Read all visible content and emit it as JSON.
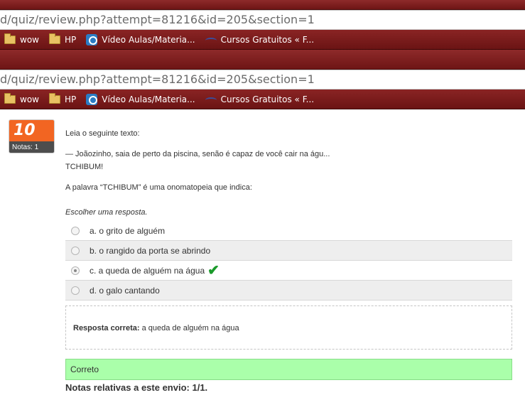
{
  "browser": {
    "url": "d/quiz/review.php?attempt=81216&id=205&section=1",
    "bookmarks": [
      {
        "icon": "folder-icon",
        "label": "wow"
      },
      {
        "icon": "folder-icon",
        "label": "HP"
      },
      {
        "icon": "site-icon",
        "label": "Vídeo Aulas/Materia..."
      },
      {
        "icon": "bird-icon",
        "label": "Cursos Gratuitos « F..."
      }
    ]
  },
  "question": {
    "number": "10",
    "grade_label": "Notas: 1",
    "intro": "Leia o seguinte texto:",
    "quote_line1": "— Joãozinho, saia de perto da piscina, senão é capaz de você cair na águ...",
    "quote_line2": "TCHIBUM!",
    "prompt": "A palavra “TCHIBUM” é uma onomatopeia que indica:",
    "choose": "Escolher uma resposta.",
    "answers": [
      {
        "label": "a. o grito de alguém",
        "checked": false
      },
      {
        "label": "b. o rangido da porta se abrindo",
        "checked": false
      },
      {
        "label": "c. a queda de alguém na água",
        "checked": true,
        "correct_icon": "checkmark-icon"
      },
      {
        "label": "d. o galo cantando",
        "checked": false
      }
    ],
    "correct_answer_label": "Resposta correta:",
    "correct_answer_value": "a queda de alguém na água",
    "status": "Correto",
    "grade_summary": "Notas relativas a este envio: 1/1."
  },
  "colors": {
    "chrome_red": "#7a1c1c",
    "question_badge": "#f26522",
    "correct_bg": "#aaffaa",
    "check_green": "#1a9a2a"
  }
}
